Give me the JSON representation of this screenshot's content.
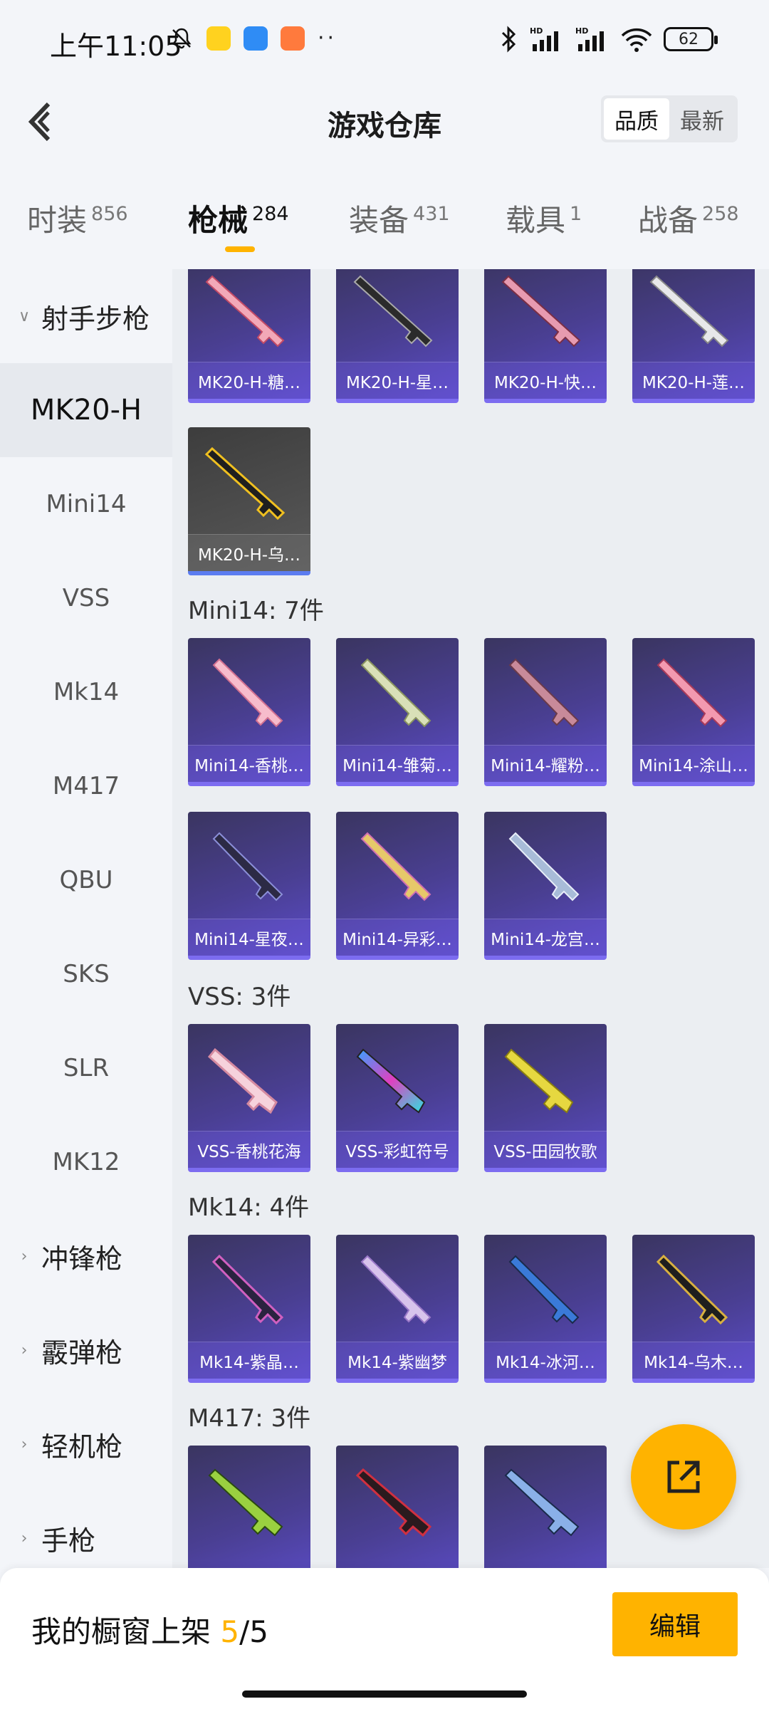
{
  "status_bar": {
    "time": "上午11:05",
    "battery": "62",
    "signal_label": "HD"
  },
  "header": {
    "title": "游戏仓库",
    "sort_options": [
      "品质",
      "最新"
    ],
    "sort_selected": "品质"
  },
  "tabs": [
    {
      "label": "时装",
      "count": "856"
    },
    {
      "label": "枪械",
      "count": "284"
    },
    {
      "label": "装备",
      "count": "431"
    },
    {
      "label": "载具",
      "count": "1"
    },
    {
      "label": "战备",
      "count": "258"
    }
  ],
  "active_tab": "枪械",
  "sidebar": {
    "groups": {
      "rifle": "射手步枪",
      "smg": "冲锋枪",
      "shotgun": "霰弹枪",
      "lmg": "轻机枪",
      "pistol": "手枪"
    },
    "items": [
      "MK20-H",
      "Mini14",
      "VSS",
      "Mk14",
      "M417",
      "QBU",
      "SKS",
      "SLR",
      "MK12"
    ],
    "active_item": "MK20-H"
  },
  "sections": {
    "mk20": {
      "cards": [
        "MK20-H-糖…",
        "MK20-H-星…",
        "MK20-H-快…",
        "MK20-H-莲…",
        "MK20-H-乌…"
      ]
    },
    "mini14": {
      "title": "Mini14: 7件",
      "cards": [
        "Mini14-香桃…",
        "Mini14-雏菊…",
        "Mini14-耀粉…",
        "Mini14-涂山…",
        "Mini14-星夜…",
        "Mini14-异彩…",
        "Mini14-龙宫…"
      ]
    },
    "vss": {
      "title": "VSS: 3件",
      "cards": [
        "VSS-香桃花海",
        "VSS-彩虹符号",
        "VSS-田园牧歌"
      ]
    },
    "mk14": {
      "title": "Mk14: 4件",
      "cards": [
        "Mk14-紫晶…",
        "Mk14-紫幽梦",
        "Mk14-冰河…",
        "Mk14-乌木…"
      ]
    },
    "m417": {
      "title": "M417: 3件"
    }
  },
  "bottom": {
    "label": "我的橱窗上架",
    "current": "5",
    "total": "/5",
    "edit": "编辑"
  },
  "colors": {
    "accent": "#ffb300",
    "card_purple": "#4a3f93",
    "card_gray": "#4e4e4e"
  }
}
